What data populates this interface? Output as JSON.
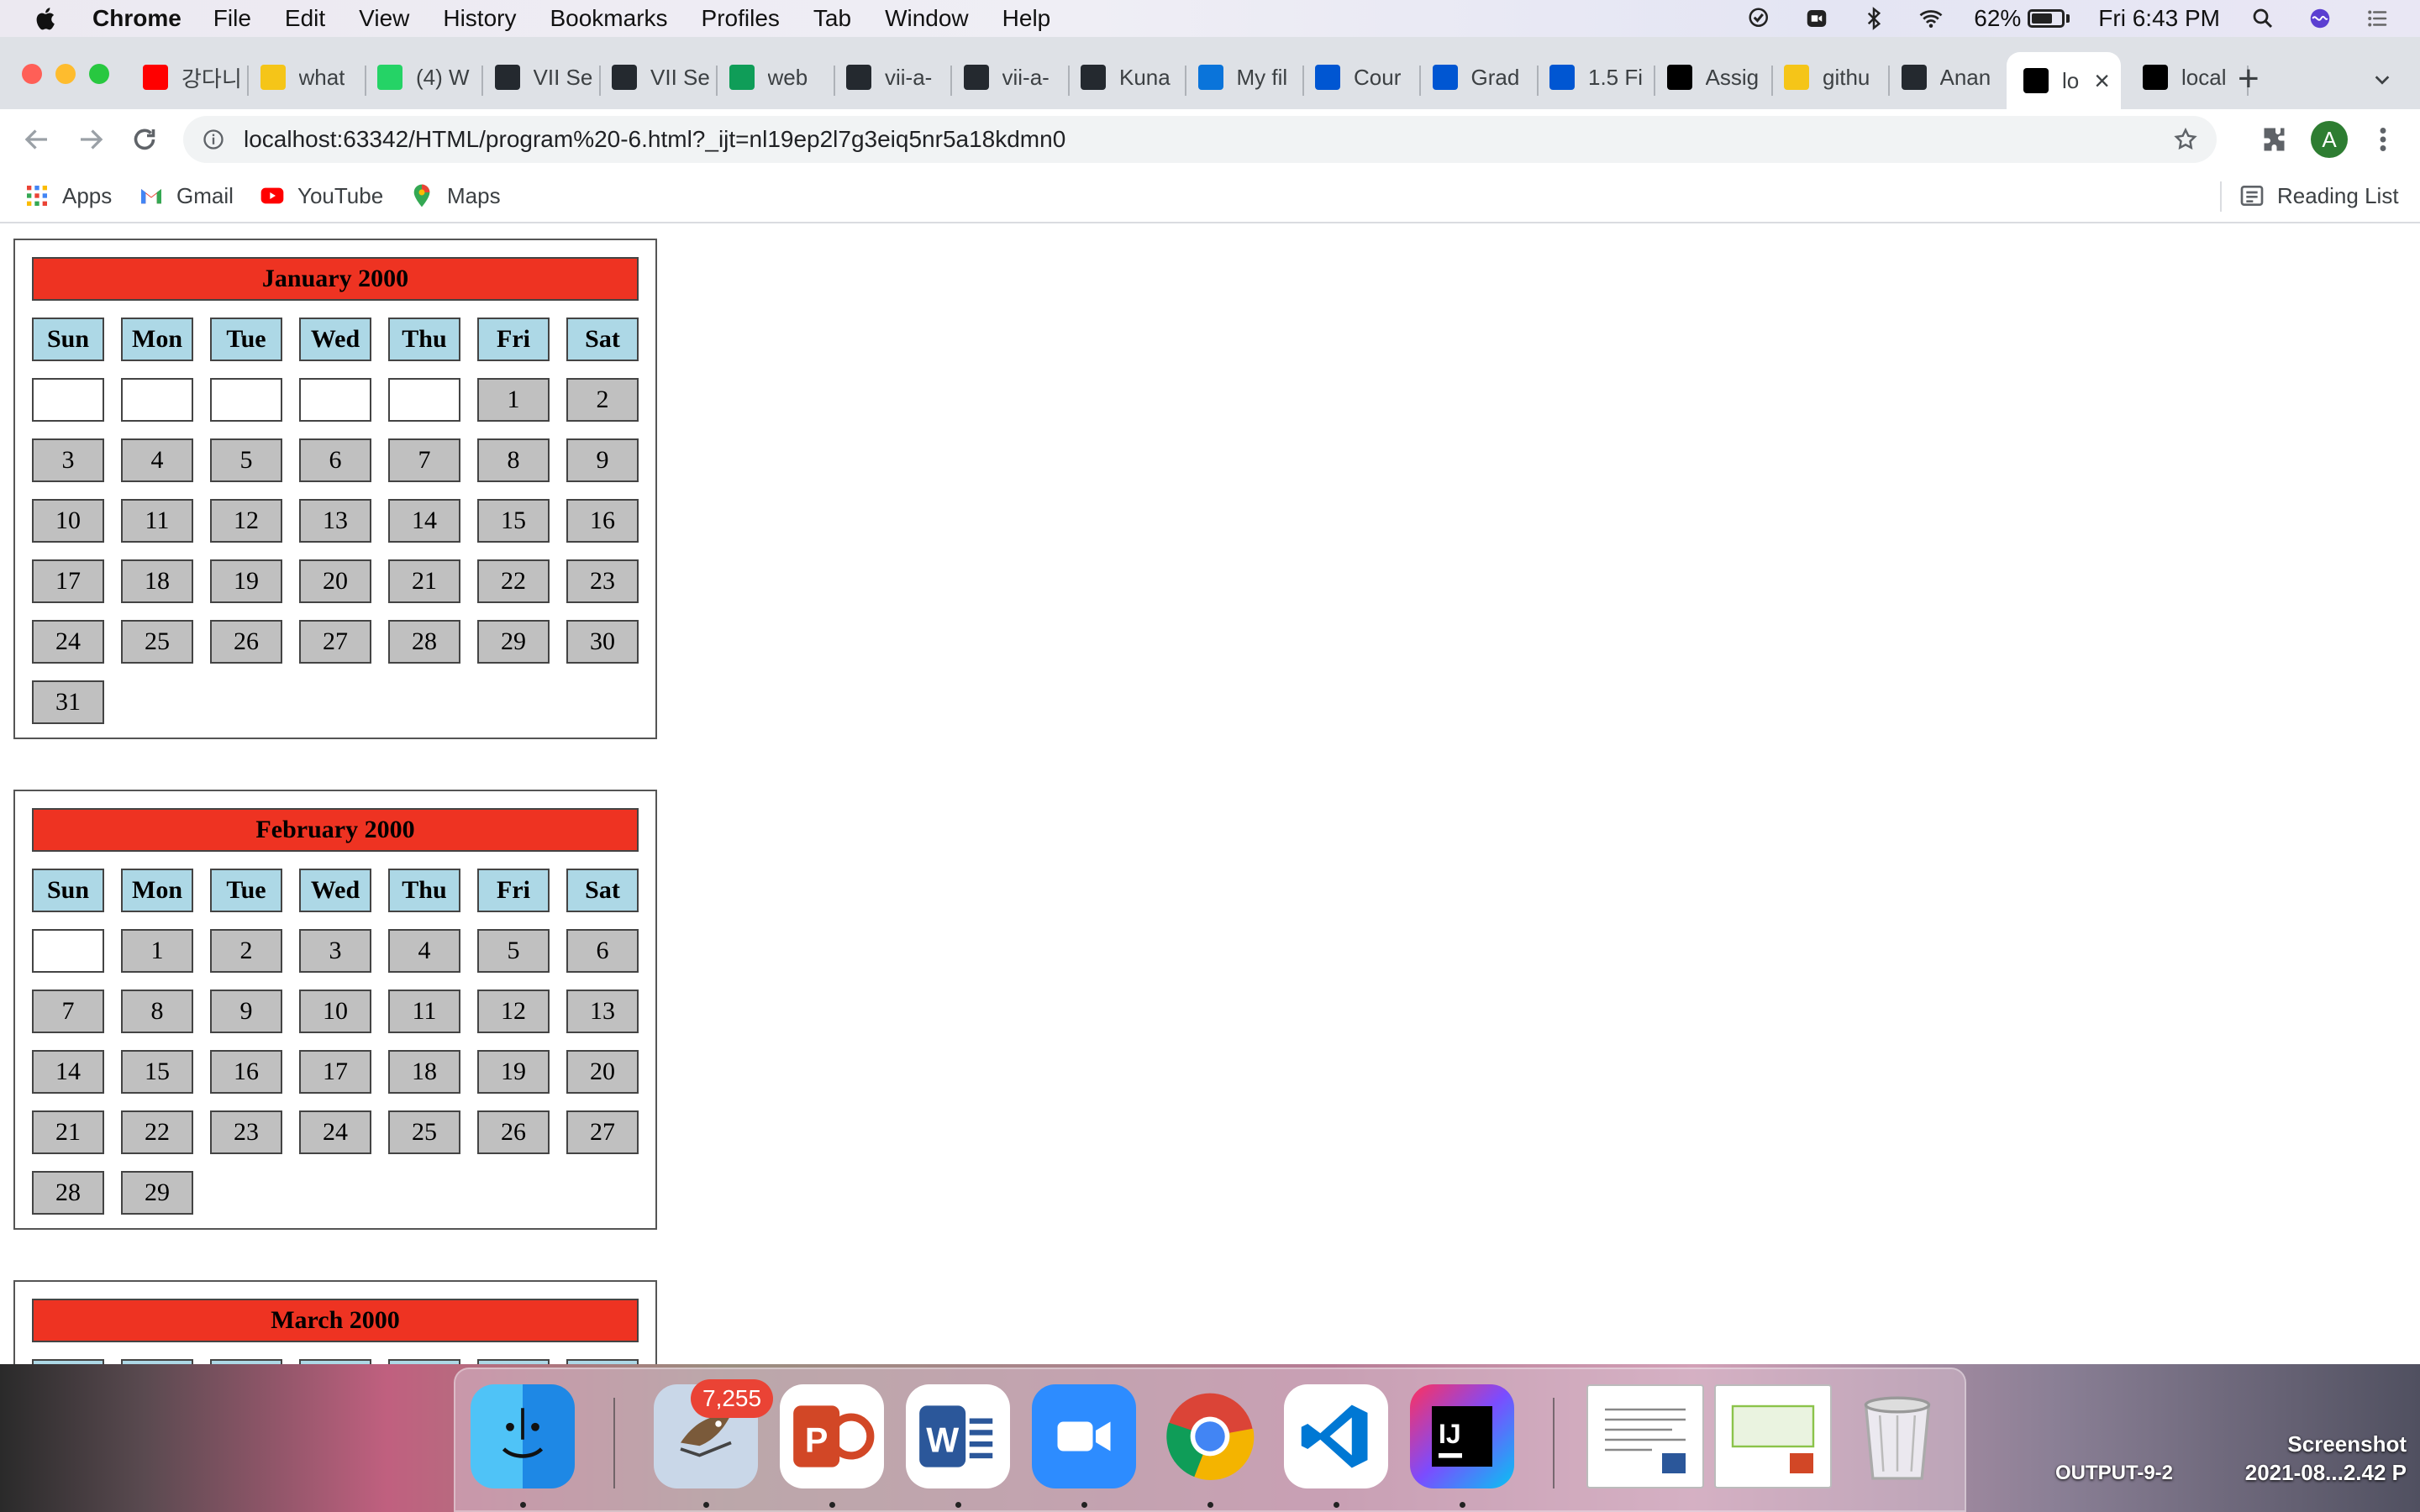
{
  "menubar": {
    "app_name": "Chrome",
    "menus": [
      "File",
      "Edit",
      "View",
      "History",
      "Bookmarks",
      "Profiles",
      "Tab",
      "Window",
      "Help"
    ],
    "battery_percent": "62%",
    "clock": "Fri 6:43 PM"
  },
  "tabs": [
    {
      "title": "강다니",
      "icon": "youtube-icon",
      "color": "#ff0000"
    },
    {
      "title": "what",
      "icon": "checkmark-icon",
      "color": "#f5c518"
    },
    {
      "title": "(4) W",
      "icon": "whatsapp-icon",
      "color": "#25d366"
    },
    {
      "title": "VII Se",
      "icon": "github-icon",
      "color": "#24292f"
    },
    {
      "title": "VII Se",
      "icon": "github-icon",
      "color": "#24292f"
    },
    {
      "title": "web",
      "icon": "sheets-icon",
      "color": "#0f9d58"
    },
    {
      "title": "vii-a-",
      "icon": "github-icon",
      "color": "#24292f"
    },
    {
      "title": "vii-a-",
      "icon": "github-icon",
      "color": "#24292f"
    },
    {
      "title": "Kuna",
      "icon": "github-icon",
      "color": "#24292f"
    },
    {
      "title": "My fil",
      "icon": "onedrive-icon",
      "color": "#0a74da"
    },
    {
      "title": "Cour",
      "icon": "coursera-icon",
      "color": "#0056d2"
    },
    {
      "title": "Grad",
      "icon": "coursera-icon",
      "color": "#0056d2"
    },
    {
      "title": "1.5 Fi",
      "icon": "coursera-icon",
      "color": "#0056d2"
    },
    {
      "title": "Assig",
      "icon": "intellij-icon",
      "color": "#000000"
    },
    {
      "title": "githu",
      "icon": "checkmark-icon",
      "color": "#f5c518"
    },
    {
      "title": "Anan",
      "icon": "github-icon",
      "color": "#24292f"
    },
    {
      "title": "lo",
      "icon": "intellij-icon",
      "color": "#000000",
      "active": true
    },
    {
      "title": "local",
      "icon": "intellij-icon",
      "color": "#000000"
    }
  ],
  "address_bar": {
    "url": "localhost:63342/HTML/program%20-6.html?_ijt=nl19ep2l7g3eiq5nr5a18kdmn0"
  },
  "profile_initial": "A",
  "bookmarks": {
    "items": [
      "Apps",
      "Gmail",
      "YouTube",
      "Maps"
    ],
    "reading_list": "Reading List"
  },
  "colors": {
    "title_bg": "#ee3322",
    "header_bg": "#add8e6",
    "day_bg": "#c0c0c0"
  },
  "calendar": {
    "weekdays": [
      "Sun",
      "Mon",
      "Tue",
      "Wed",
      "Thu",
      "Fri",
      "Sat"
    ],
    "months": [
      {
        "title": "January 2000",
        "weeks": [
          [
            "",
            "",
            "",
            "",
            "",
            "1",
            "2"
          ],
          [
            "3",
            "4",
            "5",
            "6",
            "7",
            "8",
            "9"
          ],
          [
            "10",
            "11",
            "12",
            "13",
            "14",
            "15",
            "16"
          ],
          [
            "17",
            "18",
            "19",
            "20",
            "21",
            "22",
            "23"
          ],
          [
            "24",
            "25",
            "26",
            "27",
            "28",
            "29",
            "30"
          ],
          [
            "31"
          ]
        ]
      },
      {
        "title": "February 2000",
        "weeks": [
          [
            "",
            "1",
            "2",
            "3",
            "4",
            "5",
            "6"
          ],
          [
            "7",
            "8",
            "9",
            "10",
            "11",
            "12",
            "13"
          ],
          [
            "14",
            "15",
            "16",
            "17",
            "18",
            "19",
            "20"
          ],
          [
            "21",
            "22",
            "23",
            "24",
            "25",
            "26",
            "27"
          ],
          [
            "28",
            "29"
          ]
        ]
      },
      {
        "title": "March 2000",
        "weeks": []
      }
    ]
  },
  "dock": {
    "mail_badge": "7,255",
    "apps": [
      "finder-icon",
      "mail-icon",
      "powerpoint-icon",
      "word-icon",
      "zoom-icon",
      "chrome-icon",
      "vscode-icon",
      "intellij-icon"
    ],
    "desktop_labels": {
      "output": "OUTPUT-9-2",
      "screenshot_line1": "Screenshot",
      "screenshot_line2": "2021-08...2.42 P"
    }
  }
}
